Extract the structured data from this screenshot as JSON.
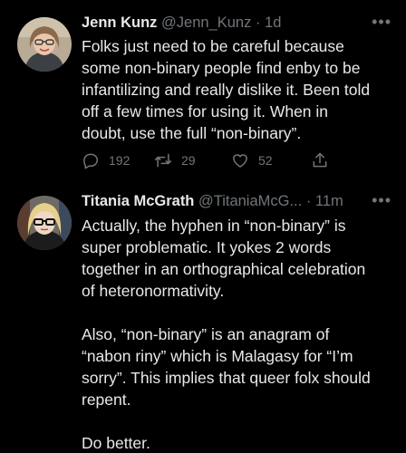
{
  "tweets": [
    {
      "name": "Jenn Kunz",
      "handle": "@Jenn_Kunz",
      "time": "· 1d",
      "more": "•••",
      "text": "Folks just need to be careful because\nsome non-binary people find enby to be\ninfantilizing and really dislike it. Been told\noff a few times for using it. When in\ndoubt, use the full “non-binary”.",
      "replies": "192",
      "retweets": "29",
      "likes": "52"
    },
    {
      "name": "Titania McGrath",
      "handle": "@TitaniaMcG...",
      "time": "· 11m",
      "more": "•••",
      "text": "Actually, the hyphen in “non-binary” is\nsuper problematic. It yokes 2 words\ntogether in an orthographical celebration\nof heteronormativity.\n\nAlso, “non-binary” is an anagram of\n“nabon riny” which is Malagasy for “I’m\nsorry”. This implies that queer folx should\nrepent.\n\nDo better."
    }
  ],
  "icons": {
    "reply": "reply-icon",
    "retweet": "retweet-icon",
    "like": "heart-icon",
    "share": "share-icon"
  },
  "colors": {
    "background": "#000000",
    "text": "#e7e9ea",
    "secondary": "#71767b"
  }
}
